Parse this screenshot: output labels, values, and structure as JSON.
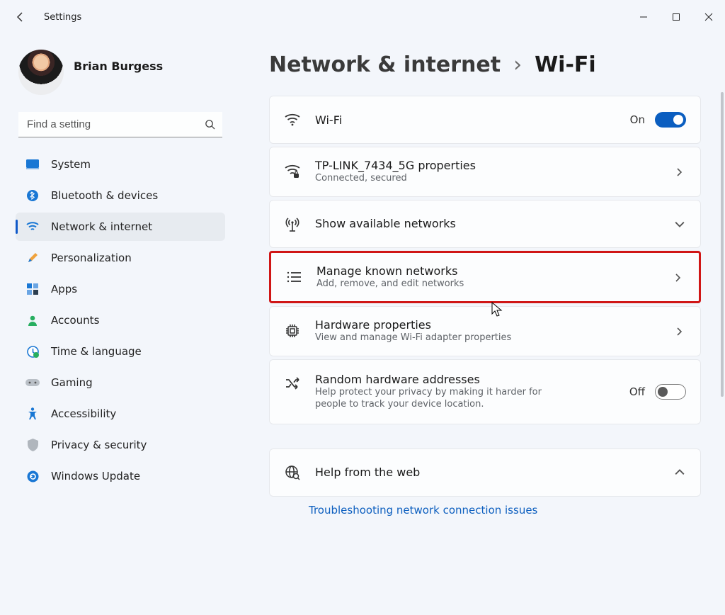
{
  "window": {
    "app_title": "Settings"
  },
  "profile": {
    "name": "Brian Burgess",
    "subtitle": ""
  },
  "search": {
    "placeholder": "Find a setting"
  },
  "sidebar": {
    "items": [
      {
        "label": "System"
      },
      {
        "label": "Bluetooth & devices"
      },
      {
        "label": "Network & internet"
      },
      {
        "label": "Personalization"
      },
      {
        "label": "Apps"
      },
      {
        "label": "Accounts"
      },
      {
        "label": "Time & language"
      },
      {
        "label": "Gaming"
      },
      {
        "label": "Accessibility"
      },
      {
        "label": "Privacy & security"
      },
      {
        "label": "Windows Update"
      }
    ],
    "active_index": 2
  },
  "breadcrumb": {
    "root": "Network & internet",
    "sep": "›",
    "leaf": "Wi-Fi"
  },
  "wifi_toggle": {
    "title": "Wi-Fi",
    "state_label": "On",
    "on": true
  },
  "connected_network": {
    "title": "TP-LINK_7434_5G properties",
    "subtitle": "Connected, secured"
  },
  "show_networks": {
    "title": "Show available networks"
  },
  "manage_known": {
    "title": "Manage known networks",
    "subtitle": "Add, remove, and edit networks"
  },
  "hardware_props": {
    "title": "Hardware properties",
    "subtitle": "View and manage Wi-Fi adapter properties"
  },
  "random_mac": {
    "title": "Random hardware addresses",
    "subtitle": "Help protect your privacy by making it harder for people to track your device location.",
    "state_label": "Off",
    "on": false
  },
  "help": {
    "title": "Help from the web",
    "link1": "Troubleshooting network connection issues"
  }
}
